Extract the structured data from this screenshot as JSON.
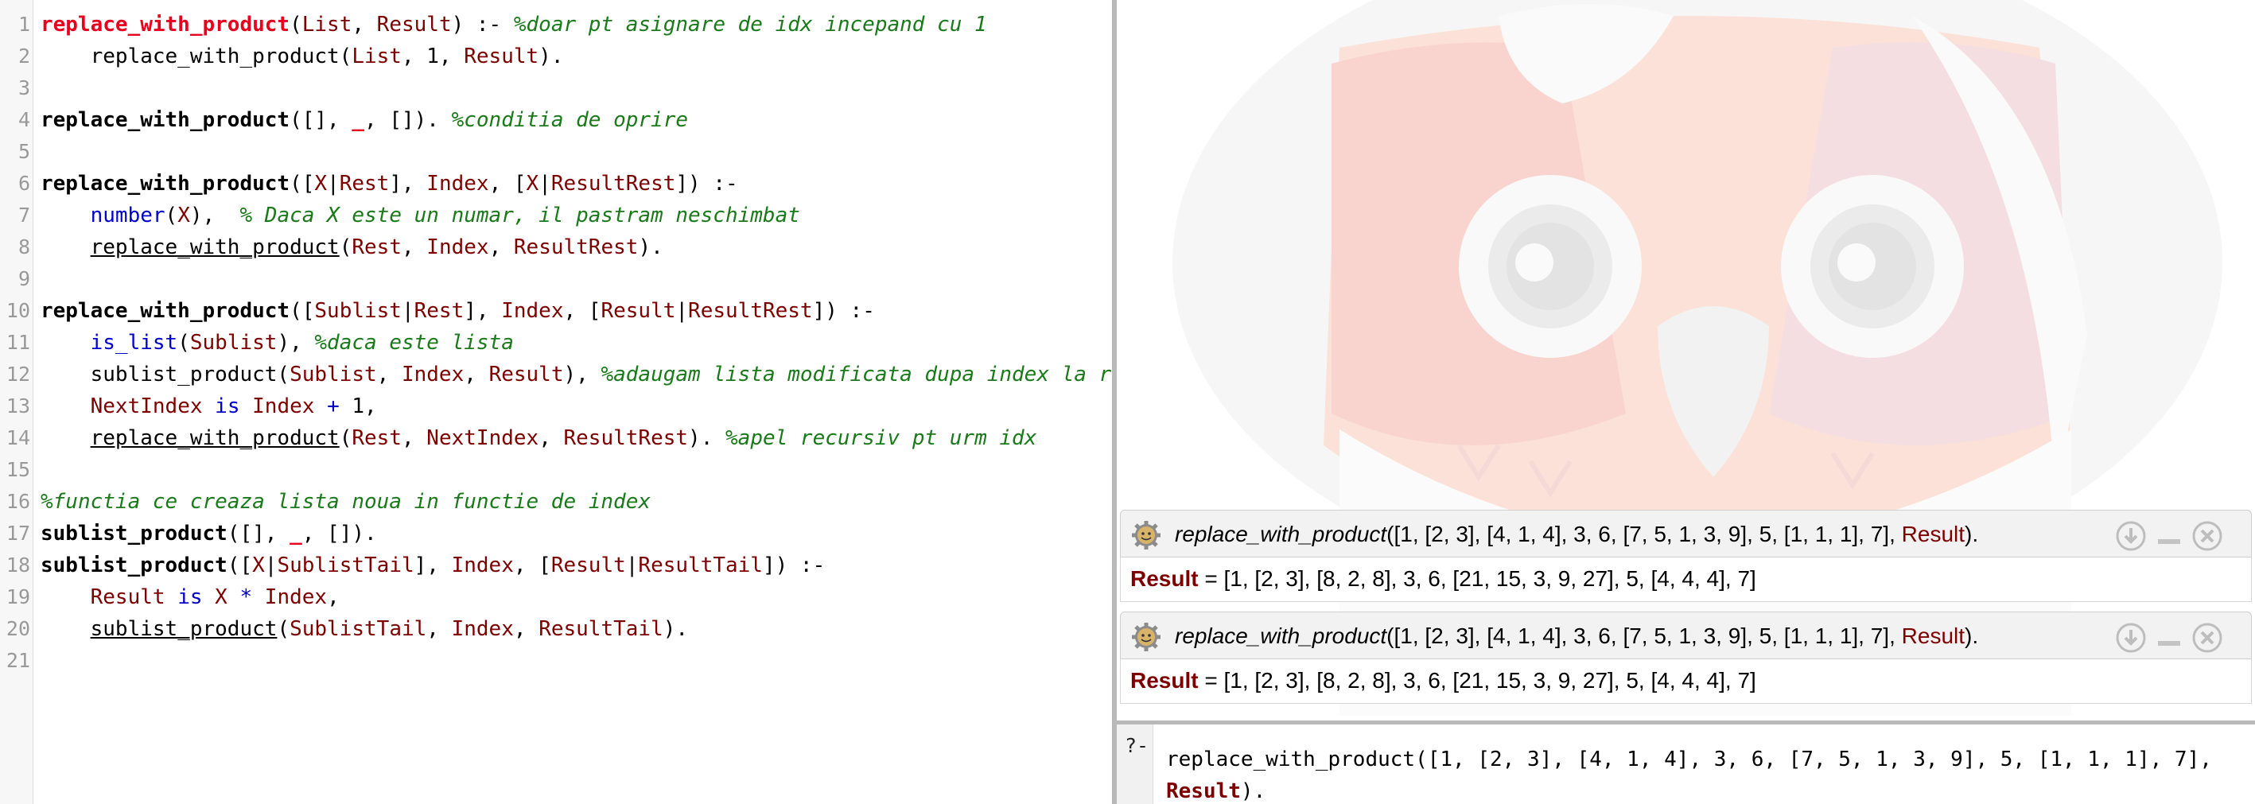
{
  "editor": {
    "lines": [
      {
        "n": "1",
        "tokens": [
          {
            "t": "replace_with_product",
            "c": "hdr"
          },
          {
            "t": "(",
            "c": ""
          },
          {
            "t": "List",
            "c": "var"
          },
          {
            "t": ", ",
            "c": ""
          },
          {
            "t": "Result",
            "c": "var"
          },
          {
            "t": ") :- ",
            "c": ""
          },
          {
            "t": "%doar pt asignare de idx incepand cu 1",
            "c": "cm"
          }
        ]
      },
      {
        "n": "2",
        "tokens": [
          {
            "t": "    replace_with_product(",
            "c": ""
          },
          {
            "t": "List",
            "c": "var"
          },
          {
            "t": ", 1, ",
            "c": ""
          },
          {
            "t": "Result",
            "c": "var"
          },
          {
            "t": ").",
            "c": ""
          }
        ]
      },
      {
        "n": "3",
        "tokens": []
      },
      {
        "n": "4",
        "tokens": [
          {
            "t": "replace_with_product",
            "c": "hd"
          },
          {
            "t": "([], ",
            "c": ""
          },
          {
            "t": "_",
            "c": "hdr"
          },
          {
            "t": ", []). ",
            "c": ""
          },
          {
            "t": "%conditia de oprire",
            "c": "cm"
          }
        ]
      },
      {
        "n": "5",
        "tokens": []
      },
      {
        "n": "6",
        "tokens": [
          {
            "t": "replace_with_product",
            "c": "hd"
          },
          {
            "t": "([",
            "c": ""
          },
          {
            "t": "X",
            "c": "var"
          },
          {
            "t": "|",
            "c": ""
          },
          {
            "t": "Rest",
            "c": "var"
          },
          {
            "t": "], ",
            "c": ""
          },
          {
            "t": "Index",
            "c": "var"
          },
          {
            "t": ", [",
            "c": ""
          },
          {
            "t": "X",
            "c": "var"
          },
          {
            "t": "|",
            "c": ""
          },
          {
            "t": "ResultRest",
            "c": "var"
          },
          {
            "t": "]) :-",
            "c": ""
          }
        ]
      },
      {
        "n": "7",
        "tokens": [
          {
            "t": "    ",
            "c": ""
          },
          {
            "t": "number",
            "c": "bi"
          },
          {
            "t": "(",
            "c": ""
          },
          {
            "t": "X",
            "c": "var"
          },
          {
            "t": "),  ",
            "c": ""
          },
          {
            "t": "% Daca X este un numar, il pastram neschimbat",
            "c": "cm"
          }
        ]
      },
      {
        "n": "8",
        "tokens": [
          {
            "t": "    ",
            "c": ""
          },
          {
            "t": "replace_with_product",
            "c": "ul"
          },
          {
            "t": "(",
            "c": ""
          },
          {
            "t": "Rest",
            "c": "var"
          },
          {
            "t": ", ",
            "c": ""
          },
          {
            "t": "Index",
            "c": "var"
          },
          {
            "t": ", ",
            "c": ""
          },
          {
            "t": "ResultRest",
            "c": "var"
          },
          {
            "t": ").",
            "c": ""
          }
        ]
      },
      {
        "n": "9",
        "tokens": []
      },
      {
        "n": "10",
        "tokens": [
          {
            "t": "replace_with_product",
            "c": "hd"
          },
          {
            "t": "([",
            "c": ""
          },
          {
            "t": "Sublist",
            "c": "var"
          },
          {
            "t": "|",
            "c": ""
          },
          {
            "t": "Rest",
            "c": "var"
          },
          {
            "t": "], ",
            "c": ""
          },
          {
            "t": "Index",
            "c": "var"
          },
          {
            "t": ", [",
            "c": ""
          },
          {
            "t": "Result",
            "c": "var"
          },
          {
            "t": "|",
            "c": ""
          },
          {
            "t": "ResultRest",
            "c": "var"
          },
          {
            "t": "]) :-",
            "c": ""
          }
        ]
      },
      {
        "n": "11",
        "tokens": [
          {
            "t": "    ",
            "c": ""
          },
          {
            "t": "is_list",
            "c": "bi"
          },
          {
            "t": "(",
            "c": ""
          },
          {
            "t": "Sublist",
            "c": "var"
          },
          {
            "t": "), ",
            "c": ""
          },
          {
            "t": "%daca este lista",
            "c": "cm"
          }
        ]
      },
      {
        "n": "12",
        "tokens": [
          {
            "t": "    sublist_product(",
            "c": ""
          },
          {
            "t": "Sublist",
            "c": "var"
          },
          {
            "t": ", ",
            "c": ""
          },
          {
            "t": "Index",
            "c": "var"
          },
          {
            "t": ", ",
            "c": ""
          },
          {
            "t": "Result",
            "c": "var"
          },
          {
            "t": "), ",
            "c": ""
          },
          {
            "t": "%adaugam lista modificata dupa index la res",
            "c": "cm"
          }
        ]
      },
      {
        "n": "13",
        "tokens": [
          {
            "t": "    ",
            "c": ""
          },
          {
            "t": "NextIndex",
            "c": "var"
          },
          {
            "t": " ",
            "c": ""
          },
          {
            "t": "is",
            "c": "bi"
          },
          {
            "t": " ",
            "c": ""
          },
          {
            "t": "Index",
            "c": "var"
          },
          {
            "t": " ",
            "c": ""
          },
          {
            "t": "+",
            "c": "bi"
          },
          {
            "t": " 1,",
            "c": ""
          }
        ]
      },
      {
        "n": "14",
        "tokens": [
          {
            "t": "    ",
            "c": ""
          },
          {
            "t": "replace_with_product",
            "c": "ul"
          },
          {
            "t": "(",
            "c": ""
          },
          {
            "t": "Rest",
            "c": "var"
          },
          {
            "t": ", ",
            "c": ""
          },
          {
            "t": "NextIndex",
            "c": "var"
          },
          {
            "t": ", ",
            "c": ""
          },
          {
            "t": "ResultRest",
            "c": "var"
          },
          {
            "t": "). ",
            "c": ""
          },
          {
            "t": "%apel recursiv pt urm idx",
            "c": "cm"
          }
        ]
      },
      {
        "n": "15",
        "tokens": []
      },
      {
        "n": "16",
        "tokens": [
          {
            "t": "%functia ce creaza lista noua in functie de index",
            "c": "cm"
          }
        ]
      },
      {
        "n": "17",
        "tokens": [
          {
            "t": "sublist_product",
            "c": "hd"
          },
          {
            "t": "([], ",
            "c": ""
          },
          {
            "t": "_",
            "c": "hdr"
          },
          {
            "t": ", []).",
            "c": ""
          }
        ]
      },
      {
        "n": "18",
        "tokens": [
          {
            "t": "sublist_product",
            "c": "hd"
          },
          {
            "t": "([",
            "c": ""
          },
          {
            "t": "X",
            "c": "var"
          },
          {
            "t": "|",
            "c": ""
          },
          {
            "t": "SublistTail",
            "c": "var"
          },
          {
            "t": "], ",
            "c": ""
          },
          {
            "t": "Index",
            "c": "var"
          },
          {
            "t": ", [",
            "c": ""
          },
          {
            "t": "Result",
            "c": "var"
          },
          {
            "t": "|",
            "c": ""
          },
          {
            "t": "ResultTail",
            "c": "var"
          },
          {
            "t": "]) :-",
            "c": ""
          }
        ]
      },
      {
        "n": "19",
        "tokens": [
          {
            "t": "    ",
            "c": ""
          },
          {
            "t": "Result",
            "c": "var"
          },
          {
            "t": " ",
            "c": ""
          },
          {
            "t": "is",
            "c": "bi"
          },
          {
            "t": " ",
            "c": ""
          },
          {
            "t": "X",
            "c": "var"
          },
          {
            "t": " ",
            "c": ""
          },
          {
            "t": "*",
            "c": "bi"
          },
          {
            "t": " ",
            "c": ""
          },
          {
            "t": "Index",
            "c": "var"
          },
          {
            "t": ",",
            "c": ""
          }
        ]
      },
      {
        "n": "20",
        "tokens": [
          {
            "t": "    ",
            "c": ""
          },
          {
            "t": "sublist_product",
            "c": "ul"
          },
          {
            "t": "(",
            "c": ""
          },
          {
            "t": "SublistTail",
            "c": "var"
          },
          {
            "t": ", ",
            "c": ""
          },
          {
            "t": "Index",
            "c": "var"
          },
          {
            "t": ", ",
            "c": ""
          },
          {
            "t": "ResultTail",
            "c": "var"
          },
          {
            "t": ").",
            "c": ""
          }
        ]
      },
      {
        "n": "21",
        "tokens": []
      }
    ]
  },
  "queries": [
    {
      "predicate": "replace_with_product",
      "args": "([1, [2, 3], [4, 1, 4], 3, 6, [7, 5, 1, 3, 9], 5, [1, 1, 1], 7], ",
      "var": "Result",
      "end": ").",
      "result_var": "Result",
      "result_value": " = [1, [2, 3], [8, 2, 8], 3, 6, [21, 15, 3, 9, 27], 5, [4, 4, 4], 7]"
    },
    {
      "predicate": "replace_with_product",
      "args": "([1, [2, 3], [4, 1, 4], 3, 6, [7, 5, 1, 3, 9], 5, [1, 1, 1], 7], ",
      "var": "Result",
      "end": ").",
      "result_var": "Result",
      "result_value": " = [1, [2, 3], [8, 2, 8], 3, 6, [21, 15, 3, 9, 27], 5, [4, 4, 4], 7]"
    }
  ],
  "query_input": {
    "prompt": "?-",
    "text_line1": "replace_with_product([1, [2, 3], [4, 1, 4], 3, 6, [7, 5, 1, 3, 9], 5, [1, 1, 1], 7],",
    "var": "Result",
    "end": ")."
  },
  "colors": {
    "keyword_head": "#e8001e",
    "variable": "#7d0000",
    "comment": "#1a7a1a",
    "builtin": "#0000cc"
  }
}
